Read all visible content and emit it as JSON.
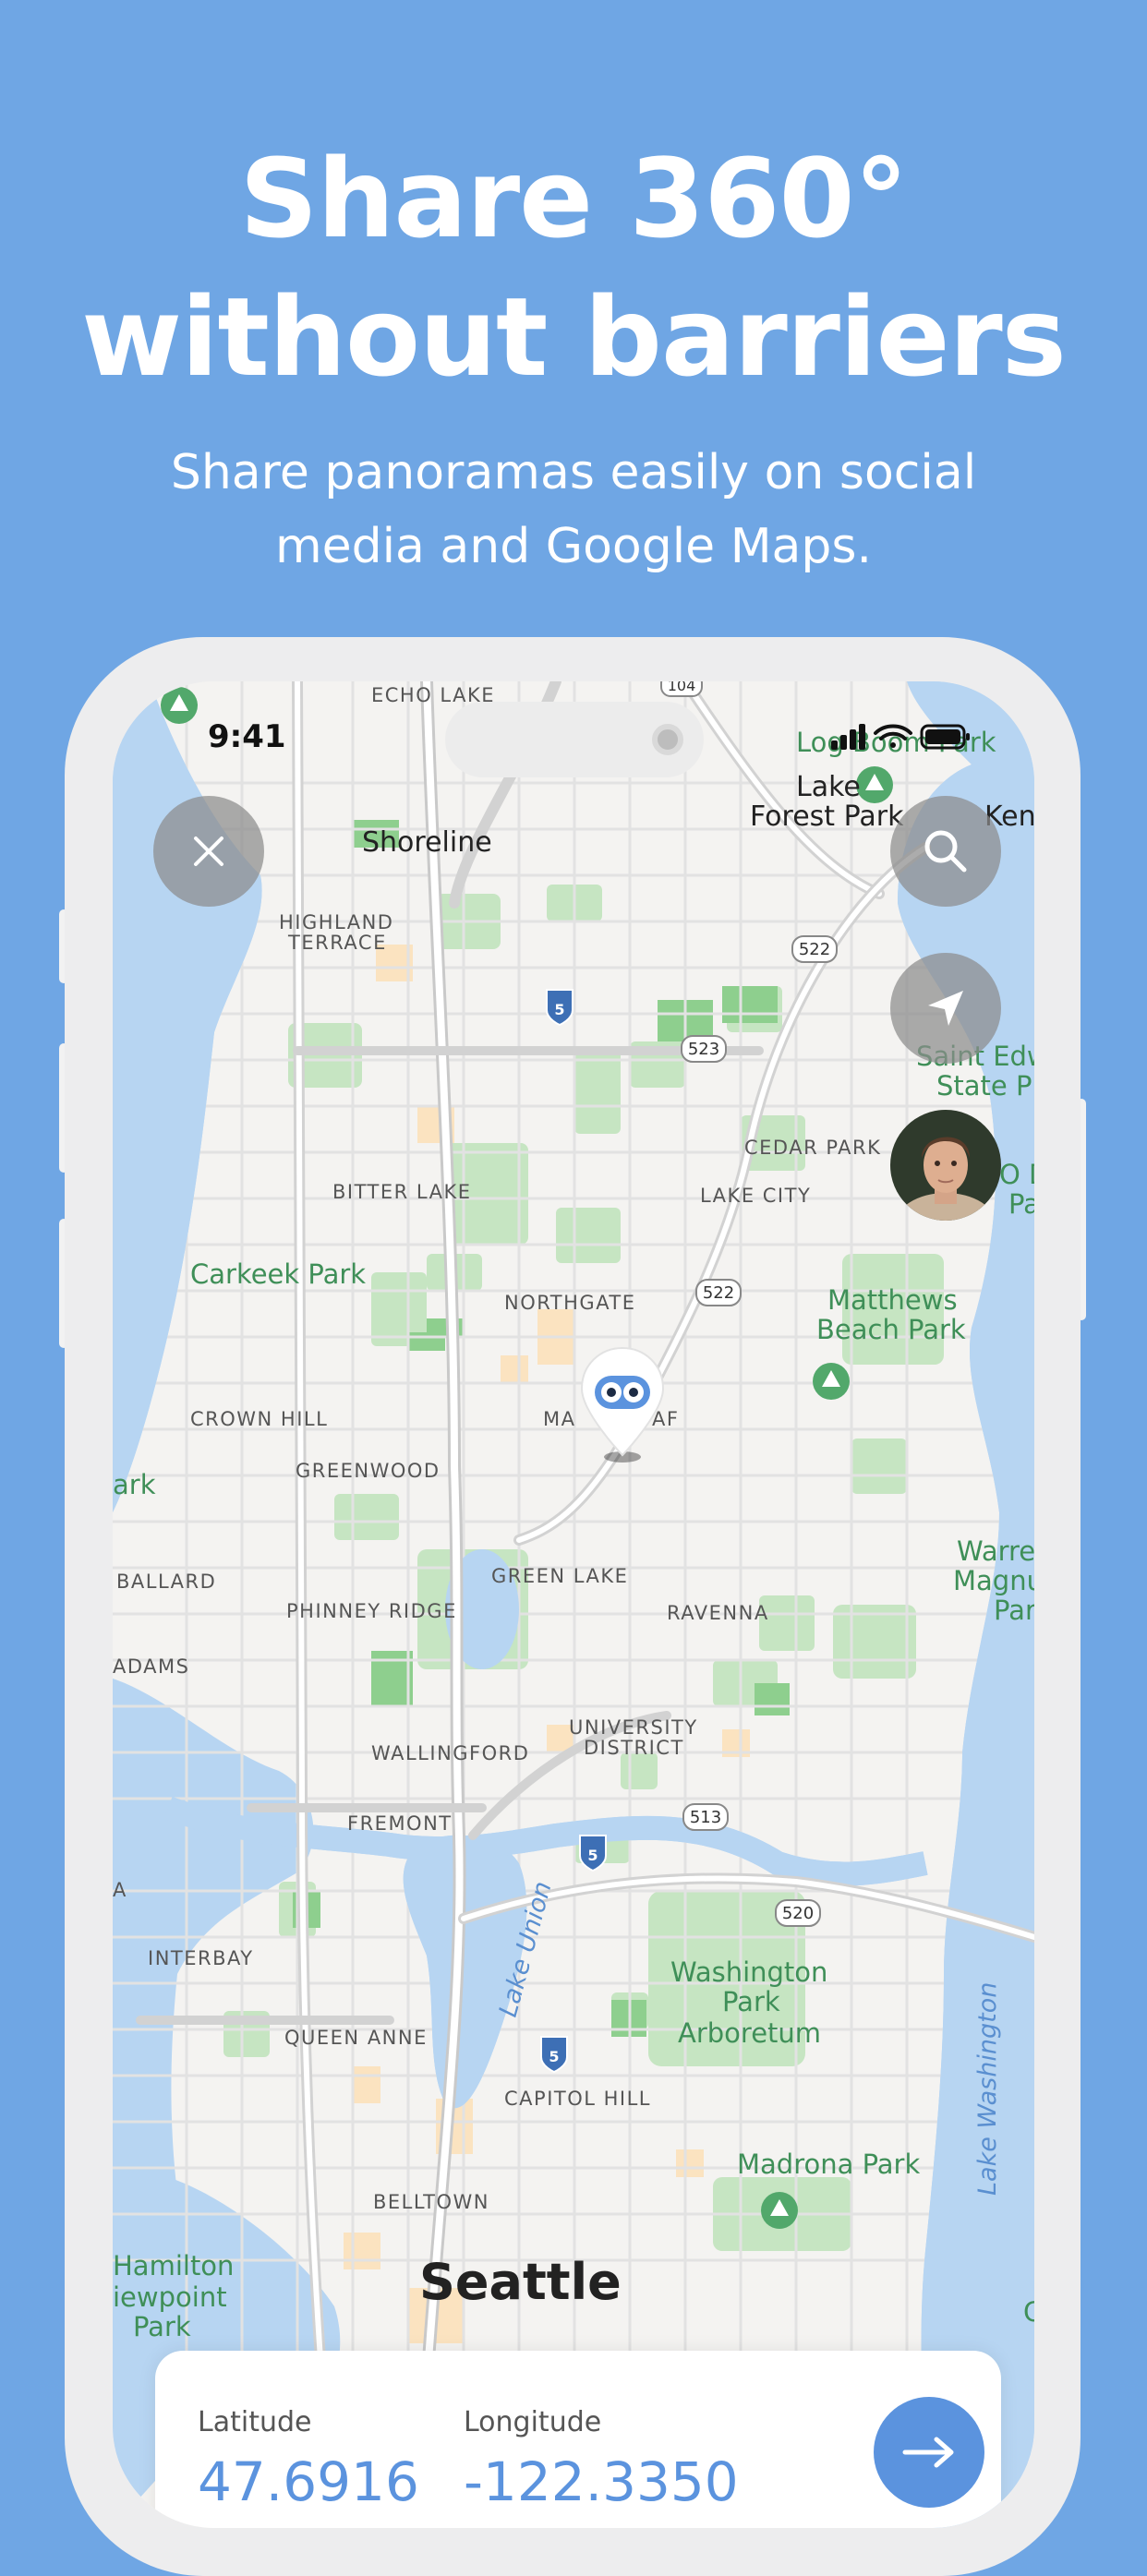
{
  "promo": {
    "headline_line1": "Share 360°",
    "headline_line2": "without barriers",
    "subhead_line1": "Share panoramas easily on social",
    "subhead_line2": "media and Google Maps."
  },
  "status_bar": {
    "time": "9:41"
  },
  "buttons": {
    "close": "close-icon",
    "search": "search-icon",
    "locate": "location-arrow-icon",
    "next": "arrow-right-icon"
  },
  "map": {
    "city_label": "Seattle",
    "place_labels": {
      "echo_lake": "ECHO LAKE",
      "shoreline": "Shoreline",
      "lake_forest_park_1": "Lake",
      "lake_forest_park_2": "Forest Park",
      "ken": "Ken",
      "log_boom_park": "Log Boom Park",
      "highland_terrace_1": "HIGHLAND",
      "highland_terrace_2": "TERRACE",
      "saint_edw_1": "Saint Edw",
      "saint_edw_2": "State P",
      "cedar_park": "CEDAR PARK",
      "bitter_lake": "BITTER LAKE",
      "lake_city": "LAKE CITY",
      "od": "O D",
      "pa": "Pa",
      "carkeek": "Carkeek Park",
      "northgate": "NORTHGATE",
      "matthews_1": "Matthews",
      "matthews_2": "Beach Park",
      "crown_hill": "CROWN HILL",
      "maple_leaf_a": "MA",
      "maple_leaf_b": "AF",
      "greenwood": "GREENWOOD",
      "ark": "ark",
      "warren_1": "Warre",
      "warren_2": "Magnu",
      "warren_3": "Par",
      "ballard": "BALLARD",
      "green_lake": "GREEN LAKE",
      "phinney": "PHINNEY RIDGE",
      "ravenna": "RAVENNA",
      "adams": "ADAMS",
      "university_1": "UNIVERSITY",
      "university_2": "DISTRICT",
      "wallingford": "WALLINGFORD",
      "fremont": "FREMONT",
      "a": "A",
      "interbay": "INTERBAY",
      "lake_union": "Lake Union",
      "washington_park_1": "Washington",
      "washington_park_2": "Park",
      "washington_park_3": "Arboretum",
      "lake_washington": "Lake Washington",
      "queen_anne": "QUEEN ANNE",
      "capitol_hill": "CAPITOL HILL",
      "madrona": "Madrona Park",
      "belltown": "BELLTOWN",
      "hamilton_1": "Hamilton",
      "hamilton_2": "iewpoint",
      "hamilton_3": "Park",
      "c": "C"
    },
    "route_shields": {
      "i5_a": "5",
      "i5_b": "5",
      "i5_c": "5",
      "r104": "104",
      "r522_a": "522",
      "r522_b": "522",
      "r523": "523",
      "r513": "513",
      "r520": "520"
    }
  },
  "coordinates": {
    "latitude_label": "Latitude",
    "latitude_value": "47.6916",
    "longitude_label": "Longitude",
    "longitude_value": "-122.3350"
  },
  "colors": {
    "background": "#6fa6e4",
    "accent": "#5b93de",
    "water": "#b7d5f2",
    "park": "#c6e5c2",
    "road": "#ffffff"
  }
}
